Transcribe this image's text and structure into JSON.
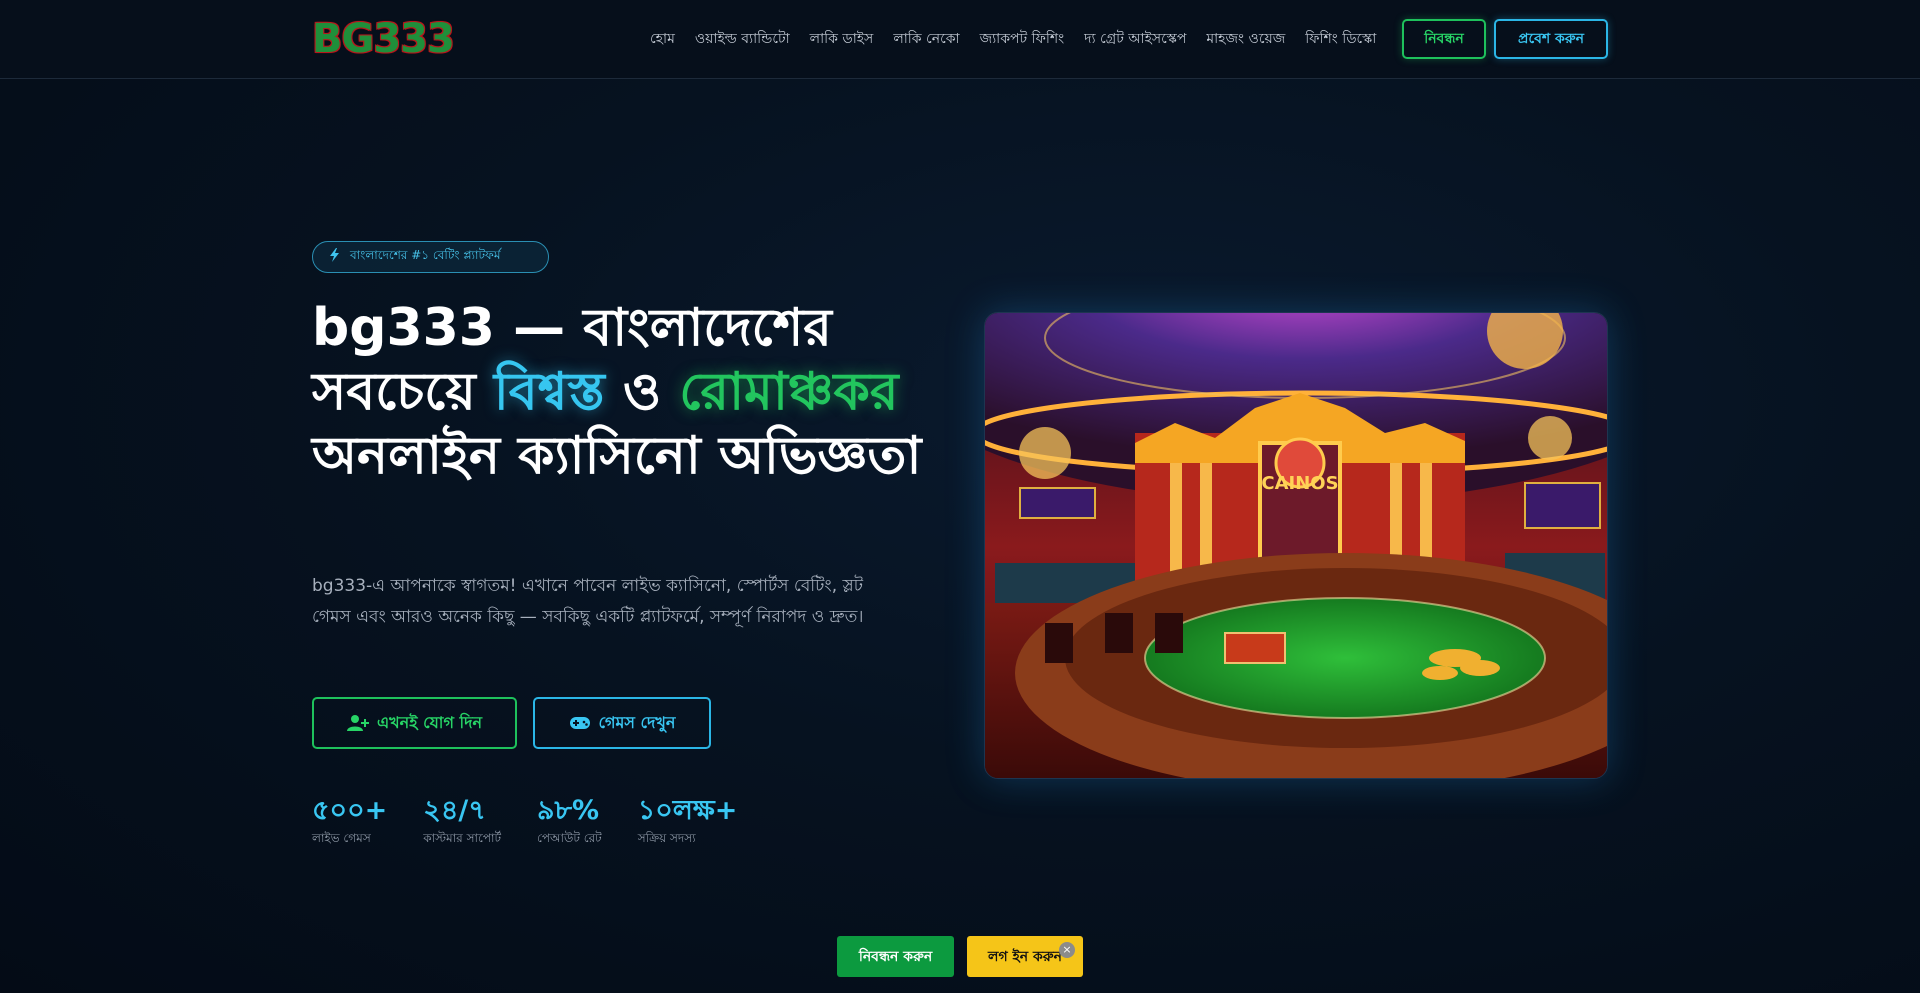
{
  "header": {
    "logo_text": "BG333",
    "nav": [
      "হোম",
      "ওয়াইল্ড ব্যান্ডিটো",
      "লাকি ডাইস",
      "লাকি নেকো",
      "জ্যাকপট ফিশিং",
      "দ্য গ্রেট আইসস্কেপ",
      "মাহজং ওয়েজ",
      "ফিশিং ডিস্কো"
    ],
    "register_label": "নিবন্ধন",
    "login_label": "প্রবেশ করুন"
  },
  "hero": {
    "badge": "বাংলাদেশের #১ বেটিং প্ল্যাটফর্ম",
    "title_part1": "bg333 — বাংলাদেশের সবচেয়ে ",
    "title_highlight_blue": "বিশ্বস্ত",
    "title_part2": " ও ",
    "title_highlight_green": "রোমাঞ্চকর",
    "title_part3": " অনলাইন ক্যাসিনো অভিজ্ঞতা",
    "description": "bg333-এ আপনাকে স্বাগতম! এখানে পাবেন লাইভ ক্যাসিনো, স্পোর্টস বেটিং, স্লট গেমস এবং আরও অনেক কিছু — সবকিছু একটি প্ল্যাটফর্মে, সম্পূর্ণ নিরাপদ ও দ্রুত।",
    "join_label": "এখনই যোগ দিন",
    "games_label": "গেমস দেখুন",
    "stats": [
      {
        "value": "৫০০+",
        "label": "লাইভ গেমস"
      },
      {
        "value": "২৪/৭",
        "label": "কাস্টমার সাপোর্ট"
      },
      {
        "value": "৯৮%",
        "label": "পেআউট রেট"
      },
      {
        "value": "১০লক্ষ+",
        "label": "সক্রিয় সদস্য"
      }
    ],
    "image_sign_text": "CAINOS"
  },
  "bottom_bar": {
    "register_label": "নিবন্ধন করুন",
    "login_label": "লগ ইন করুন",
    "close_symbol": "×"
  },
  "colors": {
    "accent_green": "#22c55e",
    "accent_blue": "#36c6f0",
    "bottom_login_yellow": "#f5c518",
    "bottom_register_green": "#0c9a3f"
  },
  "icons": [
    "bolt-icon",
    "user-plus-icon",
    "gamepad-icon",
    "close-icon"
  ]
}
